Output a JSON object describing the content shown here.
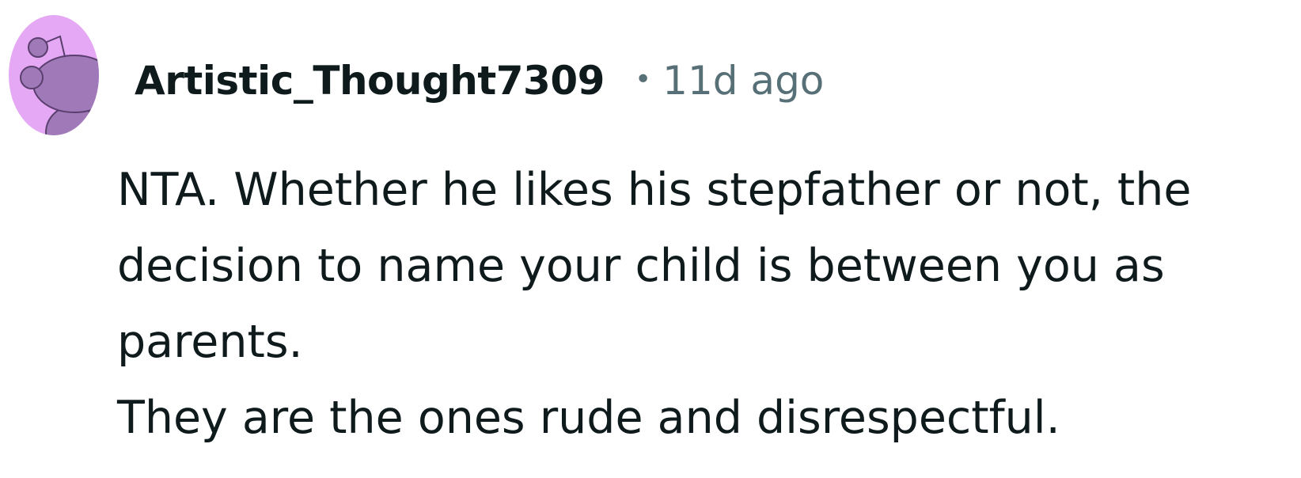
{
  "comment": {
    "author": "Artistic_Thought7309",
    "separator": "•",
    "timestamp": "11d ago",
    "avatar_icon": "reddit-snoo-avatar-icon",
    "avatar_bg_color": "#e4a8f4",
    "avatar_figure_color": "#a07ab8",
    "paragraphs": [
      "NTA. Whether he likes his stepfather or not, the decision to name your child is between you as parents.",
      "They are the ones rude and disrespectful."
    ]
  }
}
